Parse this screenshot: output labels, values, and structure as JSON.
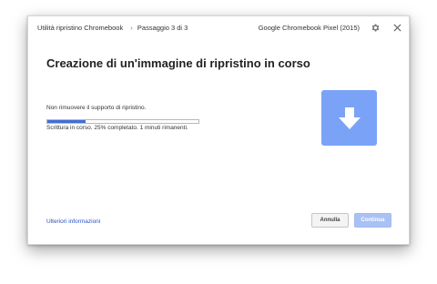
{
  "header": {
    "breadcrumb_app": "Utilità ripristino Chromebook",
    "breadcrumb_separator": "›",
    "breadcrumb_step": "Passaggio 3 di 3",
    "device_name": "Google Chromebook Pixel (2015)",
    "settings_icon": "gear-icon",
    "close_icon": "close-icon"
  },
  "main": {
    "title": "Creazione di un'immagine di ripristino in corso",
    "warning": "Non rimuovere il supporto di ripristino.",
    "progress_fraction": 0.25,
    "status": "Scrittura in corso. 25% completato. 1 minuti rimanenti.",
    "illustration_icon": "download-arrow-icon"
  },
  "footer": {
    "more_info_link": "Ulteriori informazioni",
    "cancel_label": "Annulla",
    "continue_label": "Continua"
  },
  "colors": {
    "accent": "#3e6fd8",
    "illustration": "#7aa2f7",
    "link": "#2a52be",
    "continue_disabled": "#a9c1f5"
  }
}
